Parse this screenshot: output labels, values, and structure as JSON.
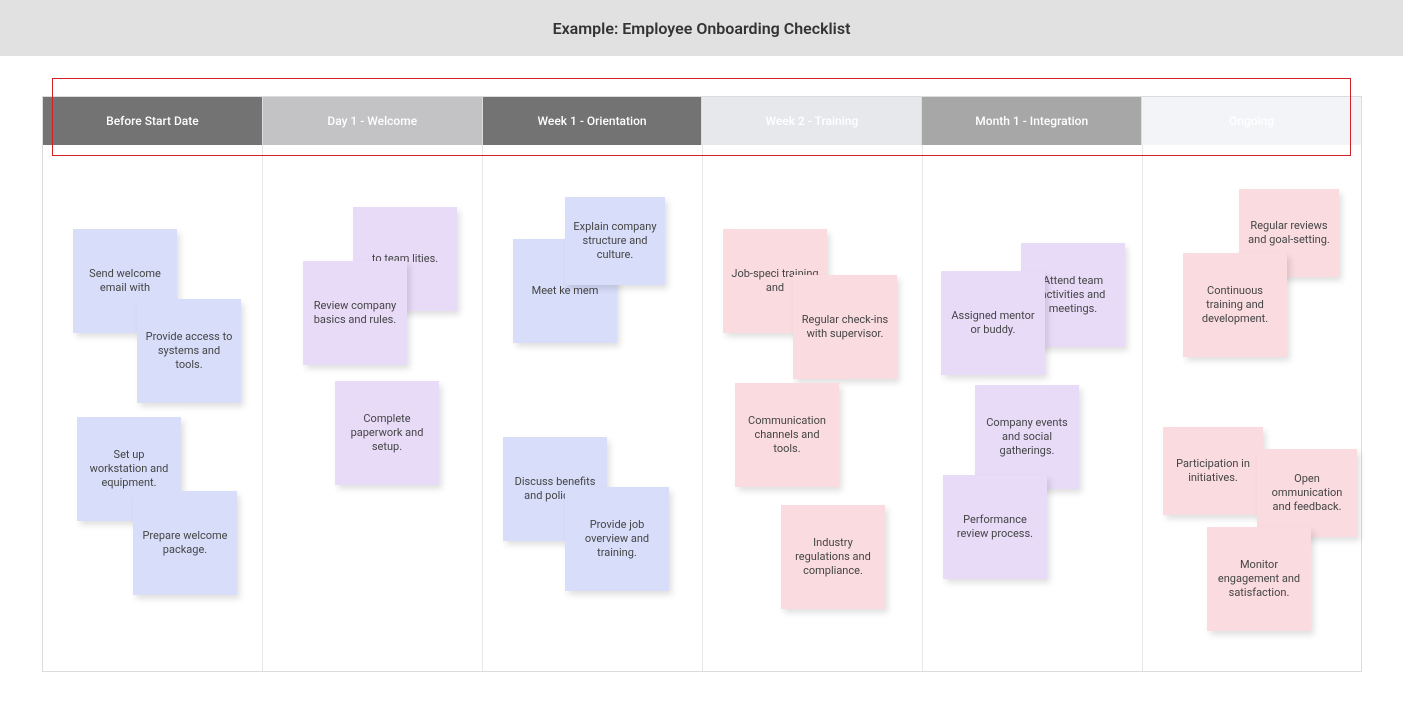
{
  "title": "Example: Employee Onboarding Checklist",
  "columns": [
    {
      "label": "Before Start Date",
      "style": "head-dark"
    },
    {
      "label": "Day 1 - Welcome",
      "style": "head-midlight"
    },
    {
      "label": "Week 1 - Orientation",
      "style": "head-dark"
    },
    {
      "label": "Week 2 - Training",
      "style": "head-light"
    },
    {
      "label": "Month 1 - Integration",
      "style": "head-gray"
    },
    {
      "label": "Ongoing",
      "style": "head-pale"
    }
  ],
  "notes": {
    "before_1": "Send welcome email with",
    "before_2": "Provide access to systems and tools.",
    "before_3": "Set up workstation and equipment.",
    "before_4": "Prepare welcome package.",
    "day1_1": "to team lities.",
    "day1_2": "Review company basics and rules.",
    "day1_3": "Complete paperwork and setup.",
    "wk1_1": "Meet ke mem",
    "wk1_2": "Explain company structure and culture.",
    "wk1_3": "Discuss benefits and policies.",
    "wk1_4": "Provide job overview and training.",
    "wk2_1": "Job-speci training and",
    "wk2_2": "Regular check-ins with supervisor.",
    "wk2_3": "Communication channels and tools.",
    "wk2_4": "Industry regulations and compliance.",
    "m1_1": "Assigned mentor or buddy.",
    "m1_2": "Attend team activities and meetings.",
    "m1_3": "Company events and social gatherings.",
    "m1_4": "Performance review process.",
    "on_1": "Regular reviews and goal-setting.",
    "on_2": "Continuous training and development.",
    "on_3": "Participation in initiatives.",
    "on_4": "Open ommunication and feedback.",
    "on_5": "Monitor engagement and satisfaction."
  }
}
